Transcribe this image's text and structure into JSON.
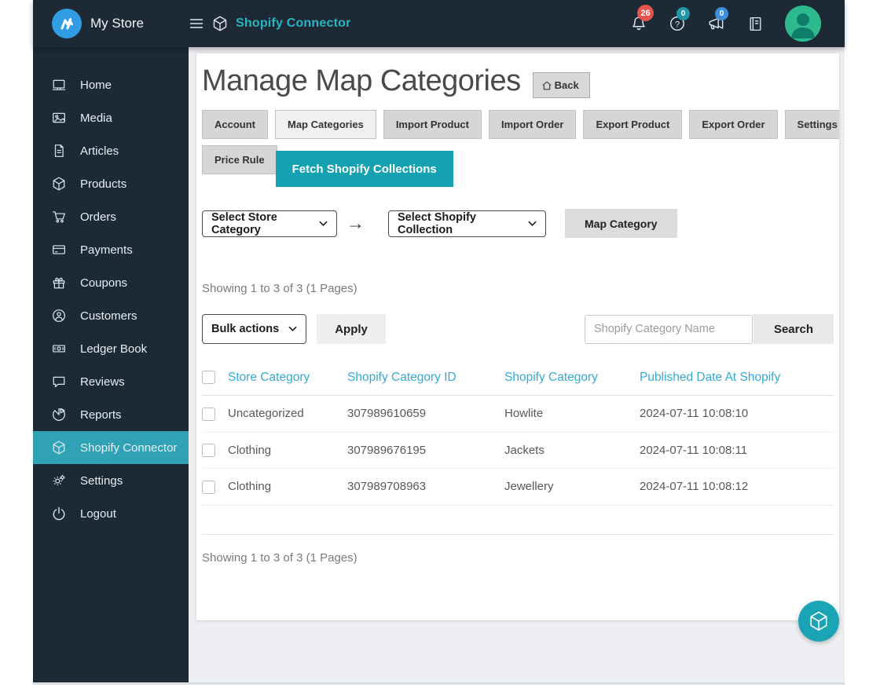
{
  "colors": {
    "header_bg": "#1d2a36",
    "sidebar_bg": "#1c2a36",
    "sidebar_active": "#2fa3b5",
    "accent_teal": "#14a1b2",
    "fab_teal": "#1ba4b6",
    "table_header_blue": "#35aad2",
    "badge_red": "#e4544b",
    "badge_teal": "#1f98a9",
    "badge_blue": "#3e8ede",
    "logo_blue": "#2f9ce4",
    "avatar_green": "#2cba8e"
  },
  "header": {
    "store_name": "My Store",
    "module_title": "Shopify Connector",
    "icons": [
      "hamburger-icon",
      "cube-icon",
      "bell-icon",
      "help-icon",
      "megaphone-icon",
      "notebook-icon"
    ],
    "badges": {
      "bell": "26",
      "help": "0",
      "megaphone": "0"
    }
  },
  "sidebar": {
    "items": [
      {
        "label": "Home",
        "icon": "home-icon",
        "active": false
      },
      {
        "label": "Media",
        "icon": "media-icon",
        "active": false
      },
      {
        "label": "Articles",
        "icon": "article-icon",
        "active": false
      },
      {
        "label": "Products",
        "icon": "cube-icon",
        "active": false
      },
      {
        "label": "Orders",
        "icon": "cart-icon",
        "active": false
      },
      {
        "label": "Payments",
        "icon": "credit-card-icon",
        "active": false
      },
      {
        "label": "Coupons",
        "icon": "gift-icon",
        "active": false
      },
      {
        "label": "Customers",
        "icon": "user-icon",
        "active": false
      },
      {
        "label": "Ledger Book",
        "icon": "money-icon",
        "active": false
      },
      {
        "label": "Reviews",
        "icon": "comment-icon",
        "active": false
      },
      {
        "label": "Reports",
        "icon": "pie-chart-icon",
        "active": false
      },
      {
        "label": "Shopify Connector",
        "icon": "cube-icon",
        "active": true
      },
      {
        "label": "Settings",
        "icon": "gears-icon",
        "active": false
      },
      {
        "label": "Logout",
        "icon": "power-icon",
        "active": false
      }
    ]
  },
  "main": {
    "page_title": "Manage Map Categories",
    "back_label": "Back",
    "tabs": [
      {
        "label": "Account",
        "active": false
      },
      {
        "label": "Map Categories",
        "active": true
      },
      {
        "label": "Import Product",
        "active": false
      },
      {
        "label": "Import Order",
        "active": false
      },
      {
        "label": "Export Product",
        "active": false
      },
      {
        "label": "Export Order",
        "active": false
      },
      {
        "label": "Settings",
        "active": false
      },
      {
        "label": "Price Rule",
        "active": false
      }
    ],
    "fetch_button": "Fetch Shopify Collections",
    "mapping": {
      "store_category_select": "Select Store Category",
      "shopify_collection_select": "Select Shopify Collection",
      "arrow_glyph": "→",
      "map_button": "Map Category"
    },
    "showing_top": "Showing 1 to 3 of 3 (1 Pages)",
    "bulk": {
      "select_label": "Bulk actions",
      "apply_label": "Apply"
    },
    "search": {
      "placeholder": "Shopify Category Name",
      "button": "Search"
    },
    "table": {
      "columns": [
        "Store Category",
        "Shopify Category ID",
        "Shopify Category",
        "Published Date At Shopify"
      ],
      "rows": [
        [
          "Uncategorized",
          "307989610659",
          "Howlite",
          "2024-07-11 10:08:10"
        ],
        [
          "Clothing",
          "307989676195",
          "Jackets",
          "2024-07-11 10:08:11"
        ],
        [
          "Clothing",
          "307989708963",
          "Jewellery",
          "2024-07-11 10:08:12"
        ]
      ]
    },
    "showing_bottom": "Showing 1 to 3 of 3 (1 Pages)"
  }
}
